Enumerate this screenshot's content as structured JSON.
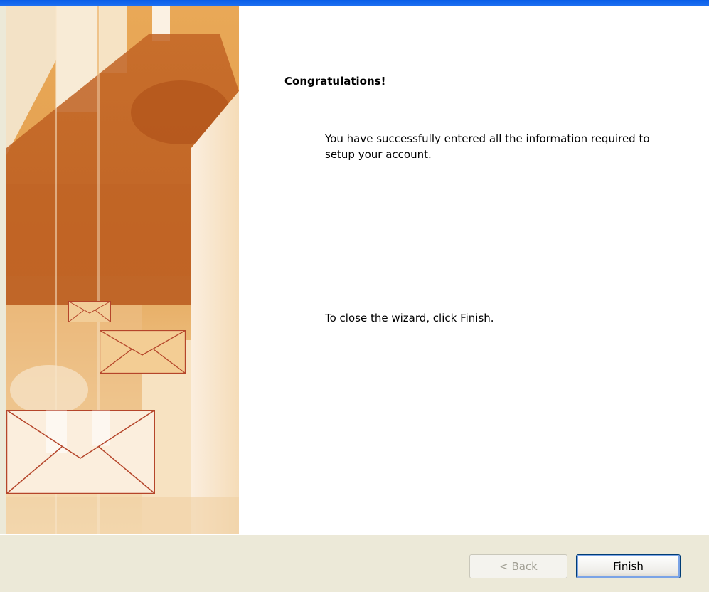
{
  "wizard": {
    "heading": "Congratulations!",
    "message_success": "You have successfully entered all the information required to\nsetup your account.",
    "message_close": "To close the wizard, click Finish."
  },
  "buttons": {
    "back_label": "< Back",
    "back_enabled": false,
    "finish_label": "Finish"
  },
  "colors": {
    "title_bar": "#0a5ee8",
    "dialog_face": "#ece9d8",
    "art_orange_dark": "#b85a1c",
    "art_orange": "#d9822b",
    "art_cream": "#f7e3c2",
    "envelope_stroke": "#b5452a"
  },
  "icons": [
    "envelope-icon-small",
    "envelope-icon-medium",
    "envelope-icon-large"
  ]
}
